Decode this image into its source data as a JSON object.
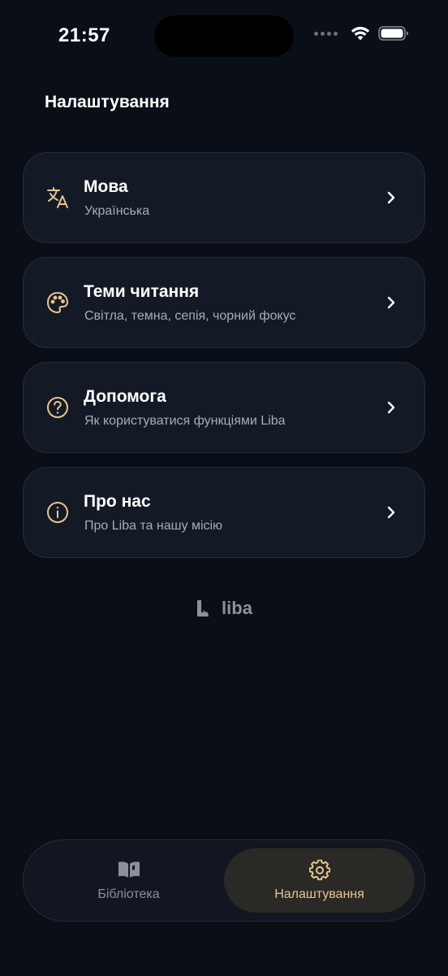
{
  "status_bar": {
    "time": "21:57"
  },
  "header": {
    "title": "Налаштування"
  },
  "settings": [
    {
      "icon": "translate-icon",
      "title": "Мова",
      "subtitle": "Українська"
    },
    {
      "icon": "palette-icon",
      "title": "Теми читання",
      "subtitle": "Світла, темна, сепія, чорний фокус"
    },
    {
      "icon": "help-circle-icon",
      "title": "Допомога",
      "subtitle": "Як користуватися функціями Liba"
    },
    {
      "icon": "info-circle-icon",
      "title": "Про нас",
      "subtitle": "Про Liba та нашу місію"
    }
  ],
  "brand": {
    "name": "liba"
  },
  "tab_bar": {
    "tabs": [
      {
        "icon": "book-open-icon",
        "label": "Бібліотека",
        "active": false
      },
      {
        "icon": "gear-icon",
        "label": "Налаштування",
        "active": true
      }
    ]
  },
  "colors": {
    "background": "#0a0e16",
    "card": "#141a25",
    "accent": "#e6c592",
    "muted_text": "#a7acb6"
  }
}
